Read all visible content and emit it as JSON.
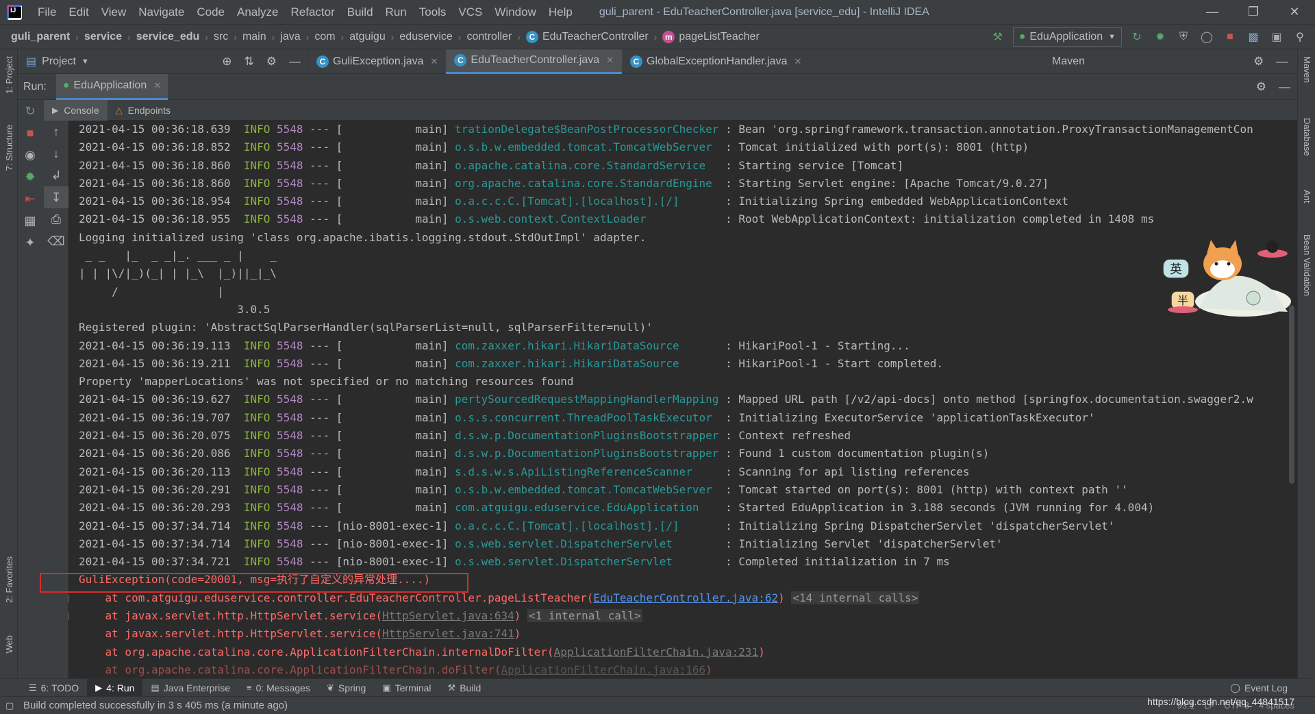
{
  "menubar": {
    "items": [
      "File",
      "Edit",
      "View",
      "Navigate",
      "Code",
      "Analyze",
      "Refactor",
      "Build",
      "Run",
      "Tools",
      "VCS",
      "Window",
      "Help"
    ],
    "title": "guli_parent - EduTeacherController.java [service_edu] - IntelliJ IDEA"
  },
  "breadcrumbs": [
    "guli_parent",
    "service",
    "service_edu",
    "src",
    "main",
    "java",
    "com",
    "atguigu",
    "eduservice",
    "controller",
    "EduTeacherController",
    "pageListTeacher"
  ],
  "run_config": "EduApplication",
  "project_pane_label": "Project",
  "editor_tabs": [
    "GuliException.java",
    "EduTeacherController.java",
    "GlobalExceptionHandler.java"
  ],
  "maven_label": "Maven",
  "left_strip": [
    "1: Project",
    "7: Structure",
    "2: Favorites",
    "Web"
  ],
  "right_strip": [
    "Maven",
    "Database",
    "Ant",
    "Bean Validation"
  ],
  "run_panel": {
    "label": "Run:",
    "app_tab": "EduApplication",
    "console_tab": "Console",
    "endpoints_tab": "Endpoints"
  },
  "console_lines": [
    {
      "t": "log",
      "ts": "2021-04-15 00:36:18.639",
      "lvl": "INFO",
      "pid": "5548",
      "sep": "---",
      "thread": "[           main]",
      "logger": "trationDelegate$BeanPostProcessorChecker",
      "msg": ": Bean 'org.springframework.transaction.annotation.ProxyTransactionManagementCon"
    },
    {
      "t": "log",
      "ts": "2021-04-15 00:36:18.852",
      "lvl": "INFO",
      "pid": "5548",
      "sep": "---",
      "thread": "[           main]",
      "logger": "o.s.b.w.embedded.tomcat.TomcatWebServer ",
      "msg": ": Tomcat initialized with port(s): 8001 (http)"
    },
    {
      "t": "log",
      "ts": "2021-04-15 00:36:18.860",
      "lvl": "INFO",
      "pid": "5548",
      "sep": "---",
      "thread": "[           main]",
      "logger": "o.apache.catalina.core.StandardService  ",
      "msg": ": Starting service [Tomcat]"
    },
    {
      "t": "log",
      "ts": "2021-04-15 00:36:18.860",
      "lvl": "INFO",
      "pid": "5548",
      "sep": "---",
      "thread": "[           main]",
      "logger": "org.apache.catalina.core.StandardEngine ",
      "msg": ": Starting Servlet engine: [Apache Tomcat/9.0.27]"
    },
    {
      "t": "log",
      "ts": "2021-04-15 00:36:18.954",
      "lvl": "INFO",
      "pid": "5548",
      "sep": "---",
      "thread": "[           main]",
      "logger": "o.a.c.c.C.[Tomcat].[localhost].[/]      ",
      "msg": ": Initializing Spring embedded WebApplicationContext"
    },
    {
      "t": "log",
      "ts": "2021-04-15 00:36:18.955",
      "lvl": "INFO",
      "pid": "5548",
      "sep": "---",
      "thread": "[           main]",
      "logger": "o.s.web.context.ContextLoader           ",
      "msg": ": Root WebApplicationContext: initialization completed in 1408 ms"
    },
    {
      "t": "plain",
      "text": "Logging initialized using 'class org.apache.ibatis.logging.stdout.StdOutImpl' adapter."
    },
    {
      "t": "plain",
      "text": " _ _   |_  _ _|_. ___ _ |    _ "
    },
    {
      "t": "plain",
      "text": "| | |\\/|_)(_| | |_\\  |_)||_|_\\ "
    },
    {
      "t": "plain",
      "text": "     /               |         "
    },
    {
      "t": "plain",
      "text": "                        3.0.5 "
    },
    {
      "t": "plain",
      "text": "Registered plugin: 'AbstractSqlParserHandler(sqlParserList=null, sqlParserFilter=null)'"
    },
    {
      "t": "log",
      "ts": "2021-04-15 00:36:19.113",
      "lvl": "INFO",
      "pid": "5548",
      "sep": "---",
      "thread": "[           main]",
      "logger": "com.zaxxer.hikari.HikariDataSource      ",
      "msg": ": HikariPool-1 - Starting..."
    },
    {
      "t": "log",
      "ts": "2021-04-15 00:36:19.211",
      "lvl": "INFO",
      "pid": "5548",
      "sep": "---",
      "thread": "[           main]",
      "logger": "com.zaxxer.hikari.HikariDataSource      ",
      "msg": ": HikariPool-1 - Start completed."
    },
    {
      "t": "plain",
      "text": "Property 'mapperLocations' was not specified or no matching resources found"
    },
    {
      "t": "log",
      "ts": "2021-04-15 00:36:19.627",
      "lvl": "INFO",
      "pid": "5548",
      "sep": "---",
      "thread": "[           main]",
      "logger": "pertySourcedRequestMappingHandlerMapping",
      "msg": ": Mapped URL path [/v2/api-docs] onto method [springfox.documentation.swagger2.w"
    },
    {
      "t": "log",
      "ts": "2021-04-15 00:36:19.707",
      "lvl": "INFO",
      "pid": "5548",
      "sep": "---",
      "thread": "[           main]",
      "logger": "o.s.s.concurrent.ThreadPoolTaskExecutor ",
      "msg": ": Initializing ExecutorService 'applicationTaskExecutor'"
    },
    {
      "t": "log",
      "ts": "2021-04-15 00:36:20.075",
      "lvl": "INFO",
      "pid": "5548",
      "sep": "---",
      "thread": "[           main]",
      "logger": "d.s.w.p.DocumentationPluginsBootstrapper",
      "msg": ": Context refreshed"
    },
    {
      "t": "log",
      "ts": "2021-04-15 00:36:20.086",
      "lvl": "INFO",
      "pid": "5548",
      "sep": "---",
      "thread": "[           main]",
      "logger": "d.s.w.p.DocumentationPluginsBootstrapper",
      "msg": ": Found 1 custom documentation plugin(s)"
    },
    {
      "t": "log",
      "ts": "2021-04-15 00:36:20.113",
      "lvl": "INFO",
      "pid": "5548",
      "sep": "---",
      "thread": "[           main]",
      "logger": "s.d.s.w.s.ApiListingReferenceScanner    ",
      "msg": ": Scanning for api listing references"
    },
    {
      "t": "log",
      "ts": "2021-04-15 00:36:20.291",
      "lvl": "INFO",
      "pid": "5548",
      "sep": "---",
      "thread": "[           main]",
      "logger": "o.s.b.w.embedded.tomcat.TomcatWebServer ",
      "msg": ": Tomcat started on port(s): 8001 (http) with context path ''"
    },
    {
      "t": "log",
      "ts": "2021-04-15 00:36:20.293",
      "lvl": "INFO",
      "pid": "5548",
      "sep": "---",
      "thread": "[           main]",
      "logger": "com.atguigu.eduservice.EduApplication   ",
      "msg": ": Started EduApplication in 3.188 seconds (JVM running for 4.004)"
    },
    {
      "t": "log",
      "ts": "2021-04-15 00:37:34.714",
      "lvl": "INFO",
      "pid": "5548",
      "sep": "---",
      "thread": "[nio-8001-exec-1]",
      "logger": "o.a.c.c.C.[Tomcat].[localhost].[/]      ",
      "msg": ": Initializing Spring DispatcherServlet 'dispatcherServlet'"
    },
    {
      "t": "log",
      "ts": "2021-04-15 00:37:34.714",
      "lvl": "INFO",
      "pid": "5548",
      "sep": "---",
      "thread": "[nio-8001-exec-1]",
      "logger": "o.s.web.servlet.DispatcherServlet       ",
      "msg": ": Initializing Servlet 'dispatcherServlet'"
    },
    {
      "t": "log",
      "ts": "2021-04-15 00:37:34.721",
      "lvl": "INFO",
      "pid": "5548",
      "sep": "---",
      "thread": "[nio-8001-exec-1]",
      "logger": "o.s.web.servlet.DispatcherServlet       ",
      "msg": ": Completed initialization in 7 ms"
    },
    {
      "t": "err",
      "text": "GuliException(code=20001, msg=执行了自定义的异常处理....)"
    },
    {
      "t": "stack",
      "pre": "    at com.atguigu.eduservice.controller.EduTeacherController.pageListTeacher(",
      "link": "EduTeacherController.java:62",
      "post": ")",
      "internal": "<14 internal calls>",
      "fold": true,
      "active": true
    },
    {
      "t": "stack",
      "pre": "    at javax.servlet.http.HttpServlet.service(",
      "link": "HttpServlet.java:634",
      "post": ")",
      "internal": "<1 internal call>",
      "fold": true,
      "active": false
    },
    {
      "t": "stack",
      "pre": "    at javax.servlet.http.HttpServlet.service(",
      "link": "HttpServlet.java:741",
      "post": ")",
      "internal": "",
      "fold": false,
      "active": false
    },
    {
      "t": "stack",
      "pre": "    at org.apache.catalina.core.ApplicationFilterChain.internalDoFilter(",
      "link": "ApplicationFilterChain.java:231",
      "post": ")",
      "internal": "",
      "fold": false,
      "active": false
    },
    {
      "t": "stack",
      "pre": "    at org.apache.catalina.core.ApplicationFilterChain.doFilter(",
      "link": "ApplicationFilterChain.java:166",
      "post": ")",
      "internal": "",
      "fold": false,
      "active": false
    }
  ],
  "bottom_tabs": [
    {
      "icon": "todo-icon",
      "label": "6: TODO"
    },
    {
      "icon": "run-icon",
      "label": "4: Run"
    },
    {
      "icon": "java-enterprise-icon",
      "label": "Java Enterprise"
    },
    {
      "icon": "messages-icon",
      "label": "0: Messages"
    },
    {
      "icon": "spring-icon",
      "label": "Spring"
    },
    {
      "icon": "terminal-icon",
      "label": "Terminal"
    },
    {
      "icon": "build-icon",
      "label": "Build"
    }
  ],
  "event_log": "Event Log",
  "status": {
    "message": "Build completed successfully in 3 s 405 ms (a minute ago)",
    "position": "93:1",
    "line_sep": "LF",
    "encoding": "UTF-8",
    "indent": "4 spaces"
  },
  "watermark": "https://blog.csdn.net/qq_44841517",
  "colors": {
    "info": "#8bb33d",
    "pid": "#b389c5",
    "logger": "#299999",
    "error": "#ff6b68",
    "link": "#5394ec",
    "highlight_box": "#d62d2d"
  }
}
